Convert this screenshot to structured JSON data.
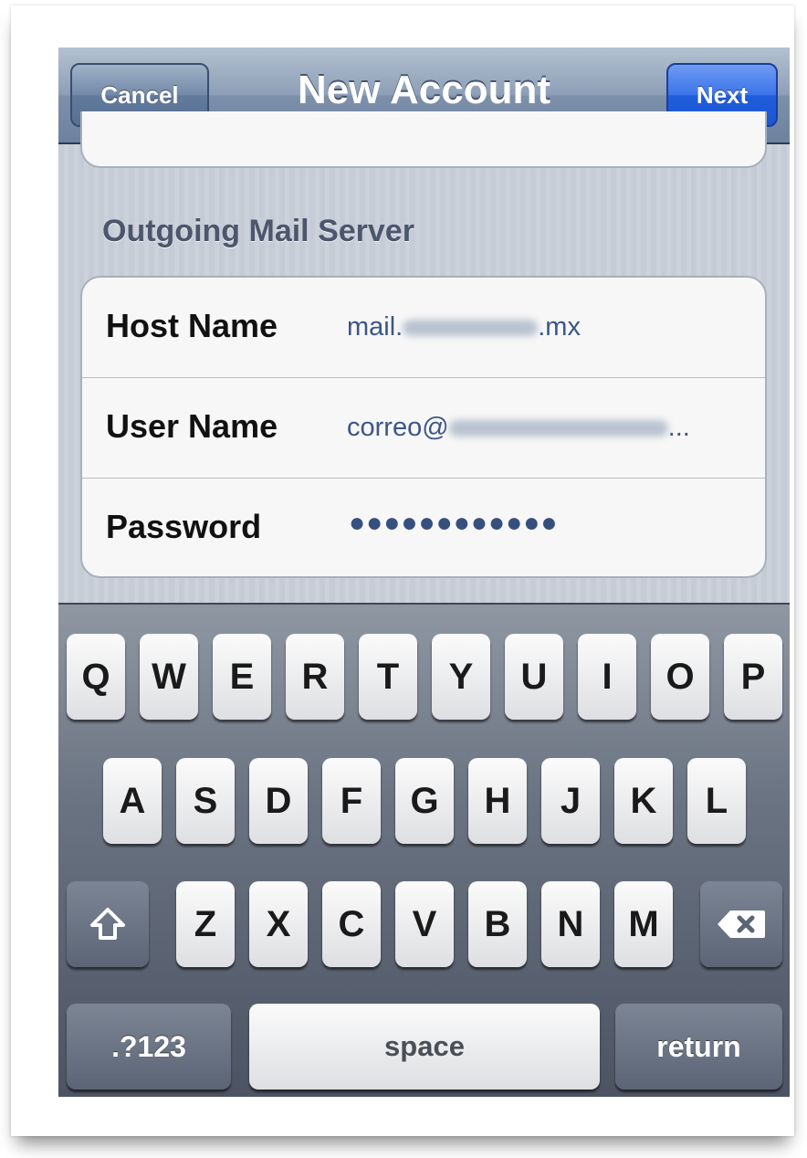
{
  "navbar": {
    "title": "New Account",
    "cancel_label": "Cancel",
    "next_label": "Next"
  },
  "section": {
    "header": "Outgoing Mail Server"
  },
  "fields": [
    {
      "label": "Host Name",
      "value_prefix": "mail.",
      "value_suffix": ".mx"
    },
    {
      "label": "User Name",
      "value_prefix": "correo@",
      "value_suffix": "..."
    },
    {
      "label": "Password",
      "value": "●●●●●●●●●●●●"
    }
  ],
  "keyboard": {
    "row1": [
      "Q",
      "W",
      "E",
      "R",
      "T",
      "Y",
      "U",
      "I",
      "O",
      "P"
    ],
    "row2": [
      "A",
      "S",
      "D",
      "F",
      "G",
      "H",
      "J",
      "K",
      "L"
    ],
    "row3": [
      "Z",
      "X",
      "C",
      "V",
      "B",
      "N",
      "M"
    ],
    "shift_icon": "shift-arrow-icon",
    "delete_icon": "backspace-icon",
    "numbers_label": ".?123",
    "space_label": "space",
    "return_label": "return"
  },
  "colors": {
    "next_button": "#2f6be6",
    "value_text": "#3b5688"
  }
}
